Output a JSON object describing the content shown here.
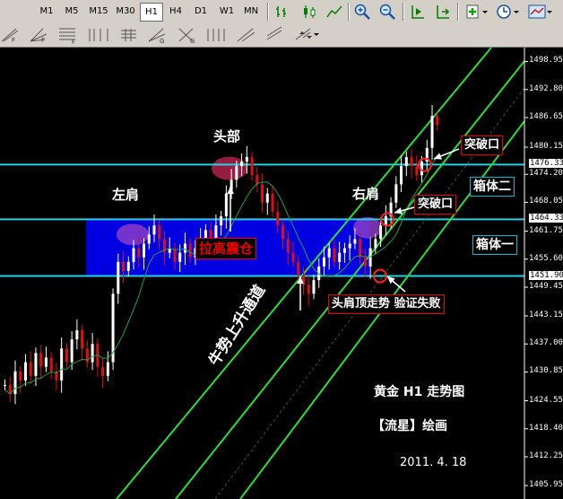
{
  "toolbar": {
    "timeframes": [
      "M1",
      "M5",
      "M15",
      "M30",
      "H1",
      "H4",
      "D1",
      "W1",
      "MN"
    ],
    "active_timeframe": "H1",
    "row1_icons": [
      "bar-chart-icon",
      "candlestick-icon",
      "line-chart-icon",
      "zoom-in-icon",
      "zoom-out-icon",
      "chart-shift-icon",
      "auto-scroll-icon",
      "indicators-icon",
      "periodicity-icon",
      "templates-icon"
    ],
    "row2_icons": [
      "fibo-arcs-icon",
      "fibo-fan-icon",
      "fibo-time-icon",
      "fibo-expansion-icon",
      "gann-line-icon",
      "gann-fan-icon",
      "gann-grid-icon",
      "cycle-lines-icon",
      "andrews-pitchfork-icon",
      "regression-icon",
      "stddev-channel-icon",
      "pitchfork-icon",
      "arrows-menu-icon"
    ]
  },
  "annotations": {
    "left_shoulder": "左肩",
    "head": "头部",
    "right_shoulder": "右肩",
    "pull_up": "拉高震仓",
    "breakout_1": "突破口",
    "breakout_2": "突破口",
    "box_two": "箱体二",
    "box_one": "箱体一",
    "hs_fail": "头肩顶走势  验证失败",
    "channel": "牛势上升通道",
    "title": "黄金   H1   走势图",
    "author": "【流星】绘画",
    "date": "2011. 4. 18"
  },
  "price_axis": {
    "ticks": [
      "1498.95",
      "1492.80",
      "1486.65",
      "1480.15",
      "1474.20",
      "1468.05",
      "1461.75",
      "1455.60",
      "1449.45",
      "1443.15",
      "1437.00",
      "1430.85",
      "1424.55",
      "1418.40",
      "1412.25",
      "1405.95"
    ],
    "level_tags": [
      "1476.33",
      "1464.33",
      "1451.90"
    ]
  },
  "chart_data": {
    "type": "candlestick",
    "instrument": "黄金",
    "timeframe": "H1",
    "ylim": [
      1403,
      1502
    ],
    "horizontal_levels": [
      1476.33,
      1464.33,
      1451.9
    ],
    "close": [
      1428,
      1426,
      1431,
      1429,
      1433,
      1430,
      1435,
      1432,
      1434,
      1431,
      1429,
      1436,
      1433,
      1438,
      1440,
      1436,
      1433,
      1437,
      1432,
      1430,
      1433,
      1448,
      1455,
      1453,
      1455,
      1458,
      1456,
      1459,
      1461,
      1463,
      1460,
      1457,
      1458,
      1455,
      1457,
      1459,
      1456,
      1458,
      1460,
      1462,
      1460,
      1463,
      1465,
      1470,
      1473,
      1476,
      1477,
      1478,
      1474,
      1472,
      1468,
      1470,
      1466,
      1463,
      1460,
      1457,
      1455,
      1452,
      1450,
      1448,
      1451,
      1454,
      1456,
      1458,
      1455,
      1457,
      1458,
      1459,
      1460,
      1456,
      1454,
      1458,
      1460,
      1463,
      1465,
      1468,
      1472,
      1476,
      1478,
      1476,
      1474,
      1477,
      1480,
      1487,
      1485
    ]
  }
}
